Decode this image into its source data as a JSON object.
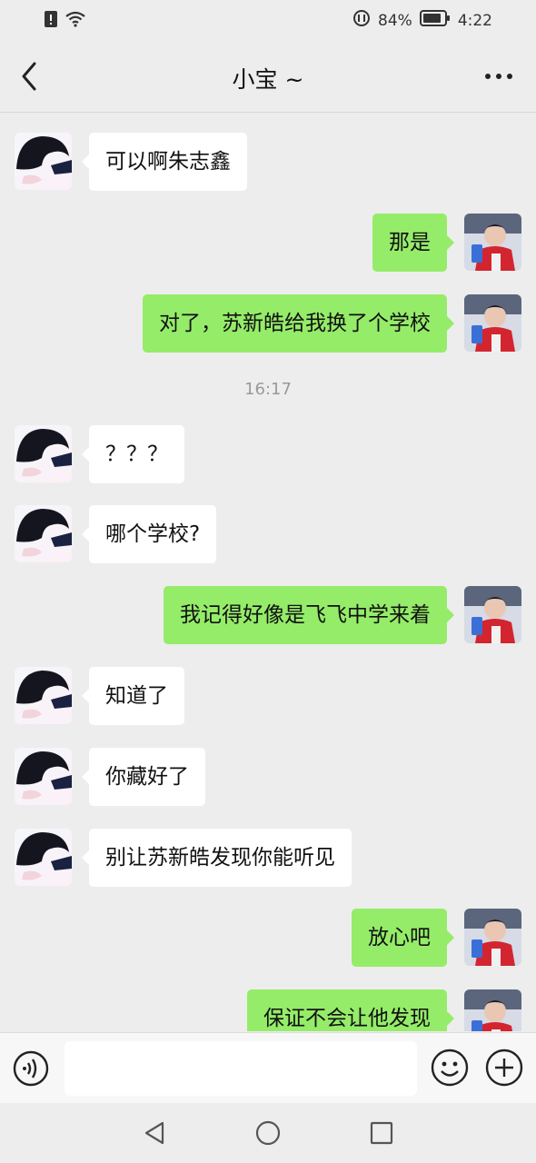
{
  "status_bar": {
    "battery_percent": "84%",
    "time": "4:22",
    "icons": [
      "alert-icon",
      "wifi-icon",
      "data-saver-icon",
      "battery-icon"
    ]
  },
  "header": {
    "title": "小宝 ~",
    "icons": [
      "back-chevron-icon",
      "more-dots-icon"
    ]
  },
  "messages": [
    {
      "side": "received",
      "text": "可以啊朱志鑫"
    },
    {
      "side": "sent",
      "text": "那是"
    },
    {
      "side": "sent",
      "text": "对了，苏新皓给我换了个学校"
    },
    {
      "type": "timestamp",
      "text": "16:17"
    },
    {
      "side": "received",
      "text": "？？？"
    },
    {
      "side": "received",
      "text": "哪个学校?"
    },
    {
      "side": "sent",
      "text": "我记得好像是飞飞中学来着"
    },
    {
      "side": "received",
      "text": "知道了"
    },
    {
      "side": "received",
      "text": "你藏好了"
    },
    {
      "side": "received",
      "text": "别让苏新皓发现你能听见"
    },
    {
      "side": "sent",
      "text": "放心吧"
    },
    {
      "side": "sent",
      "text": "保证不会让他发现"
    }
  ],
  "input_bar": {
    "value": "",
    "icons": [
      "voice-icon",
      "emoji-icon",
      "plus-icon"
    ]
  },
  "system_nav": {
    "icons": [
      "back-triangle-icon",
      "home-circle-icon",
      "recents-square-icon"
    ]
  },
  "colors": {
    "sent_bubble": "#95ec69",
    "received_bubble": "#ffffff",
    "background": "#ededed"
  }
}
